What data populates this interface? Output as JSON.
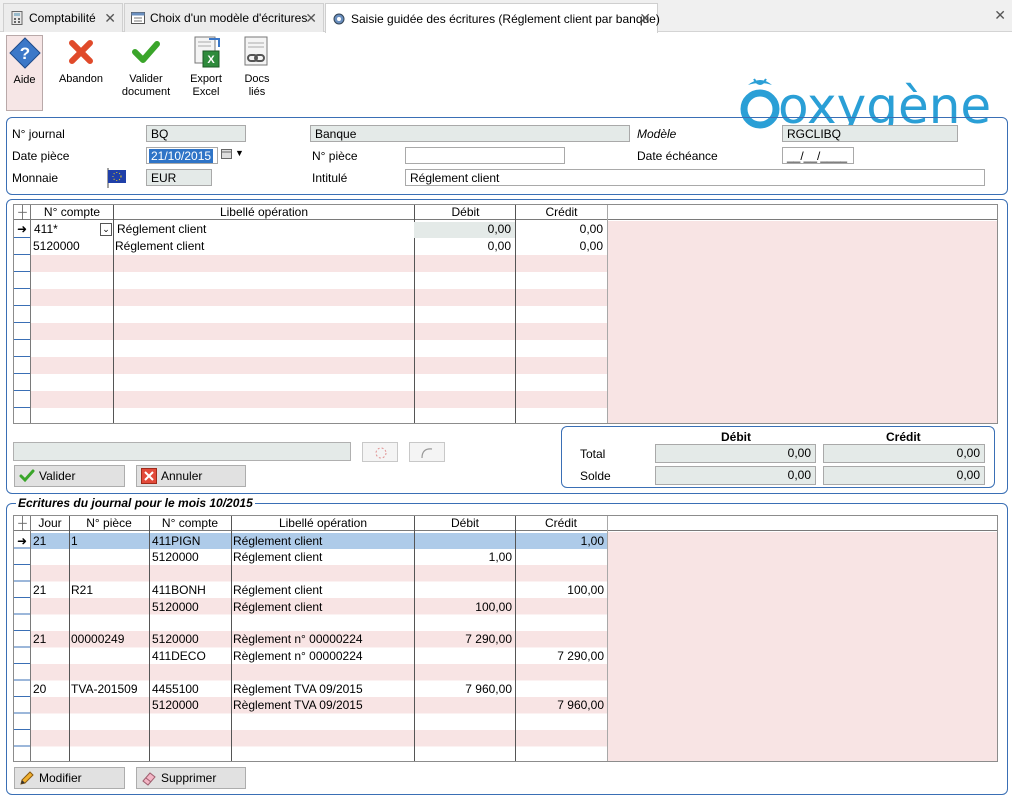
{
  "tabs": [
    {
      "label": "Comptabilité"
    },
    {
      "label": "Choix d'un modèle d'écritures"
    },
    {
      "label": "Saisie guidée des écritures (Réglement client par banque)"
    }
  ],
  "toolbar": {
    "aide": "Aide",
    "abandon": "Abandon",
    "valider_1": "Valider",
    "valider_2": "document",
    "export_1": "Export",
    "export_2": "Excel",
    "docs_1": "Docs",
    "docs_2": "liés"
  },
  "logo": {
    "text": "oxygène",
    "color": "#2a9fd6"
  },
  "header": {
    "journal_label": "N° journal",
    "journal_code": "BQ",
    "journal_name": "Banque",
    "modele_label": "Modèle",
    "modele_value": "RGCLIBQ",
    "date_piece_label": "Date pièce",
    "date_piece_value": "21/10/2015",
    "num_piece_label": "N° pièce",
    "num_piece_value": "",
    "date_echeance_label": "Date échéance",
    "date_echeance_value": "__/__/____",
    "monnaie_label": "Monnaie",
    "monnaie_value": "EUR",
    "intitule_label": "Intitulé",
    "intitule_value": "Réglement client"
  },
  "entry_grid": {
    "columns": {
      "compte": "N° compte",
      "libelle": "Libellé opération",
      "debit": "Débit",
      "credit": "Crédit"
    },
    "rows": [
      {
        "compte": "411*",
        "libelle": "Réglement client",
        "debit": "0,00",
        "credit": "0,00"
      },
      {
        "compte": "5120000",
        "libelle": "Réglement client",
        "debit": "0,00",
        "credit": "0,00"
      }
    ]
  },
  "entry_buttons": {
    "valider": "Valider",
    "annuler": "Annuler"
  },
  "totals": {
    "debit_header": "Débit",
    "credit_header": "Crédit",
    "total_label": "Total",
    "solde_label": "Solde",
    "total_debit": "0,00",
    "total_credit": "0,00",
    "solde_debit": "0,00",
    "solde_credit": "0,00"
  },
  "journal": {
    "title": "Ecritures du journal pour le mois 10/2015",
    "columns": {
      "jour": "Jour",
      "piece": "N° pièce",
      "compte": "N° compte",
      "libelle": "Libellé opération",
      "debit": "Débit",
      "credit": "Crédit"
    },
    "rows": [
      {
        "jour": "21",
        "piece": "1",
        "compte": "411PIGN",
        "libelle": "Réglement client",
        "debit": "",
        "credit": "1,00"
      },
      {
        "jour": "",
        "piece": "",
        "compte": "5120000",
        "libelle": "Réglement client",
        "debit": "1,00",
        "credit": ""
      },
      {
        "jour": "",
        "piece": "",
        "compte": "",
        "libelle": "",
        "debit": "",
        "credit": ""
      },
      {
        "jour": "21",
        "piece": "R21",
        "compte": "411BONH",
        "libelle": "Réglement client",
        "debit": "",
        "credit": "100,00"
      },
      {
        "jour": "",
        "piece": "",
        "compte": "5120000",
        "libelle": "Réglement client",
        "debit": "100,00",
        "credit": ""
      },
      {
        "jour": "",
        "piece": "",
        "compte": "",
        "libelle": "",
        "debit": "",
        "credit": ""
      },
      {
        "jour": "21",
        "piece": "00000249",
        "compte": "5120000",
        "libelle": "Règlement n° 00000224",
        "debit": "7 290,00",
        "credit": ""
      },
      {
        "jour": "",
        "piece": "",
        "compte": "411DECO",
        "libelle": "Règlement n° 00000224",
        "debit": "",
        "credit": "7 290,00"
      },
      {
        "jour": "",
        "piece": "",
        "compte": "",
        "libelle": "",
        "debit": "",
        "credit": ""
      },
      {
        "jour": "20",
        "piece": "TVA-201509",
        "compte": "4455100",
        "libelle": "Règlement TVA 09/2015",
        "debit": "7 960,00",
        "credit": ""
      },
      {
        "jour": "",
        "piece": "",
        "compte": "5120000",
        "libelle": "Règlement TVA 09/2015",
        "debit": "",
        "credit": "7 960,00"
      }
    ]
  },
  "journal_buttons": {
    "modifier": "Modifier",
    "supprimer": "Supprimer"
  }
}
